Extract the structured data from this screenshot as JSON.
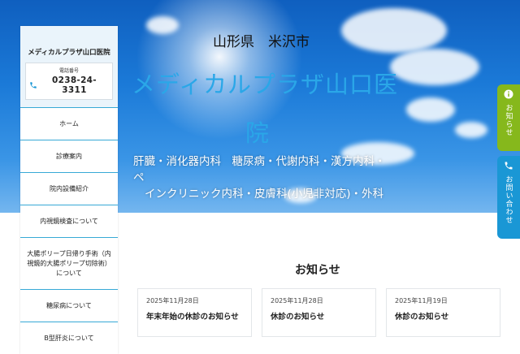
{
  "hero": {
    "prefecture": "山形県　米沢市",
    "clinic_name_line1": "メディカルプラザ山口医",
    "clinic_name_line2": "院",
    "departments_line1": "肝臓・消化器内科　糖尿病・代謝内科・漢方内科・ペ",
    "departments_line2": "インクリニック内科・皮膚科(小児非対応)・外科"
  },
  "sidebar": {
    "title": "メディカルプラザ山口医院",
    "phone_label": "電話番号",
    "phone_number": "0238-24-3311",
    "items": [
      {
        "label": "ホーム"
      },
      {
        "label": "診療案内"
      },
      {
        "label": "院内設備紹介"
      },
      {
        "label": "内視鏡検査について"
      },
      {
        "label": "大腸ポリープ日帰り手術（内視鏡的大腸ポリープ切除術）について"
      },
      {
        "label": "糖尿病について"
      },
      {
        "label": "B型肝炎について"
      }
    ]
  },
  "side_tabs": {
    "news": "お知らせ",
    "contact": "お問い合わせ"
  },
  "news": {
    "heading": "お知らせ",
    "items": [
      {
        "date": "2025年11月28日",
        "title": "年末年始の休診のお知らせ"
      },
      {
        "date": "2025年11月28日",
        "title": "休診のお知らせ"
      },
      {
        "date": "2025年11月19日",
        "title": "休診のお知らせ"
      }
    ]
  },
  "colors": {
    "accent_green": "#86b81c",
    "accent_blue": "#1a97d5",
    "nav_divider": "#37a9d6",
    "clinic_name": "#2aa7e8"
  }
}
